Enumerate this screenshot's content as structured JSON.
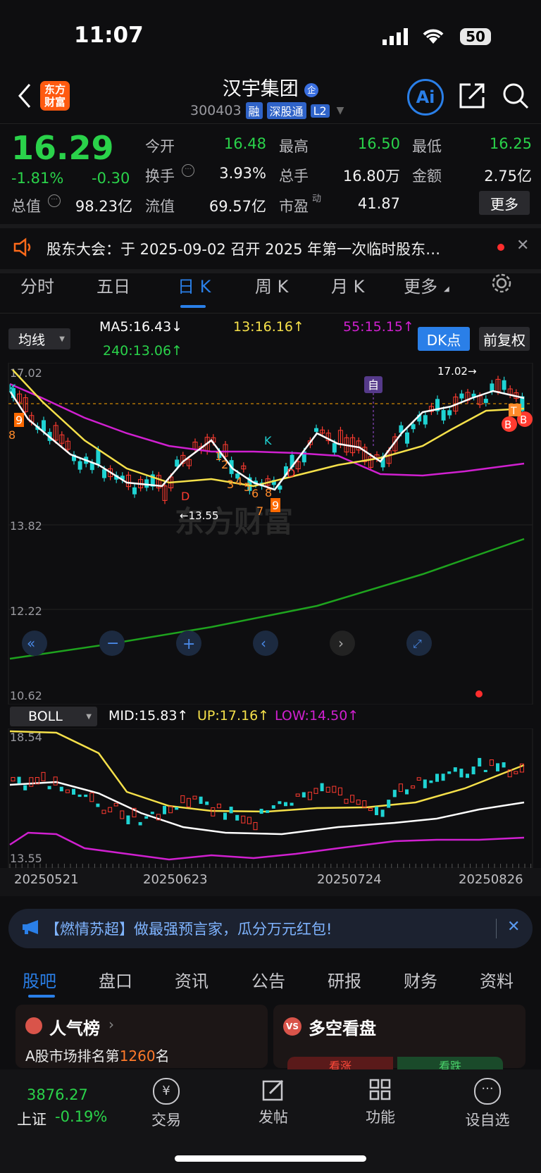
{
  "status_bar": {
    "time": "11:07",
    "battery": "50"
  },
  "header": {
    "logo_text": "东方\n财富",
    "stock_name": "汉宇集团",
    "stock_code": "300403",
    "tags": [
      "融",
      "深股通",
      "L2"
    ],
    "ai_label": "Ai"
  },
  "quote": {
    "price": "16.29",
    "change_pct": "-1.81%",
    "change_abs": "-0.30",
    "fields": [
      {
        "label": "今开",
        "value": "16.48",
        "color": "#2ad24a"
      },
      {
        "label": "最高",
        "value": "16.50",
        "color": "#2ad24a"
      },
      {
        "label": "最低",
        "value": "16.25",
        "color": "#2ad24a"
      },
      {
        "label": "换手",
        "value": "3.93%",
        "color": "#f2f2f2"
      },
      {
        "label": "总手",
        "value": "16.80万",
        "color": "#f2f2f2"
      },
      {
        "label": "金额",
        "value": "2.75亿",
        "color": "#f2f2f2"
      },
      {
        "label": "总值",
        "value": "98.23亿",
        "color": "#f2f2f2"
      },
      {
        "label": "流值",
        "value": "69.57亿",
        "color": "#f2f2f2"
      },
      {
        "label": "市盈",
        "value": "41.87",
        "color": "#f2f2f2"
      }
    ],
    "pe_superscript": "动",
    "more_button": "更多"
  },
  "notice": {
    "text": "股东大会：于 2025-09-02 召开 2025 年第一次临时股东…"
  },
  "period_tabs": [
    "分时",
    "五日",
    "日 K",
    "周 K",
    "月 K",
    "更多"
  ],
  "active_period": "日 K",
  "kline": {
    "indicator_select": "均线",
    "ma5": "MA5:16.43",
    "ma13": "13:16.16",
    "ma55": "55:15.15",
    "ma240": "240:13.06",
    "dk_button": "DK点",
    "adjust_button": "前复权",
    "axis_labels": [
      "17.02",
      "13.82",
      "12.22",
      "10.62"
    ],
    "high_marker": "17.02→",
    "low_marker": "←13.55",
    "watermark": "东方财富",
    "self_marker": "自"
  },
  "boll": {
    "indicator_select": "BOLL",
    "mid": "MID:15.83",
    "up": "UP:17.16",
    "low": "LOW:14.50",
    "axis_labels": [
      "18.54",
      "13.55"
    ]
  },
  "dates": [
    "20250521",
    "20250623",
    "20250724",
    "20250826"
  ],
  "colors": {
    "up": "#ff3b30",
    "down": "#1fd3d3",
    "ma5": "#ffffff",
    "ma13": "#f5e04a",
    "ma55": "#d020d0",
    "ma240": "#1ea31e",
    "accent": "#2a7fe8"
  },
  "banner": {
    "text": "【燃情苏超】做最强预言家，瓜分万元红包!"
  },
  "bottom_tabs": [
    "股吧",
    "盘口",
    "资讯",
    "公告",
    "研报",
    "财务",
    "资料"
  ],
  "active_bottom_tab": "股吧",
  "cards": {
    "popularity_title": "人气榜",
    "popularity_text": "A股市场排名第",
    "popularity_rank": "1260",
    "popularity_suffix": "名",
    "bull_bear_title": "多空看盘",
    "bull": "看涨",
    "bear": "看跌"
  },
  "footer": {
    "index_value": "3876.27",
    "index_name": "上证",
    "index_change": "-0.19%",
    "items": [
      "交易",
      "发帖",
      "功能",
      "设自选"
    ]
  }
}
